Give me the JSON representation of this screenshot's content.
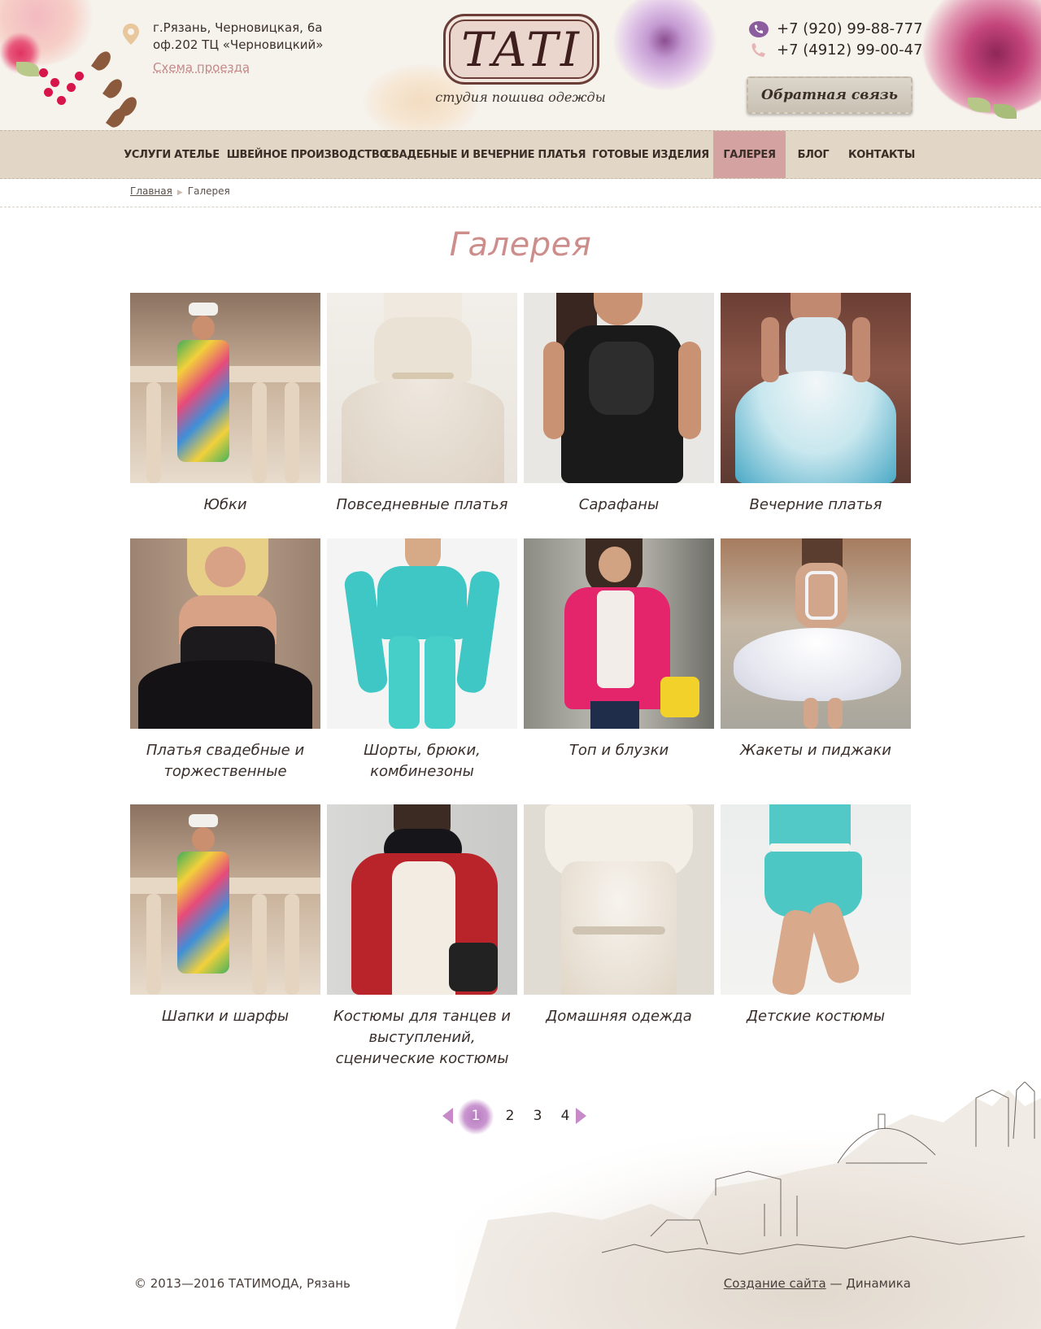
{
  "header": {
    "address_line1": "г.Рязань, Черновицкая, 6а",
    "address_line2": "оф.202  ТЦ «Черновицкий»",
    "route_link": "Схема проезда",
    "logo_text": "TATI",
    "tagline": "студия пошива одежды",
    "phone_1": "+7 (920) 99-88-777",
    "phone_2": "+7 (4912) 99-00-47",
    "callback_button": "Обратная связь"
  },
  "nav": {
    "items": [
      {
        "label": "УСЛУГИ АТЕЛЬЕ"
      },
      {
        "label": "ШВЕЙНОЕ ПРОИЗВОДСТВО"
      },
      {
        "label": "СВАДЕБНЫЕ И ВЕЧЕРНИЕ ПЛАТЬЯ"
      },
      {
        "label": "ГОТОВЫЕ ИЗДЕЛИЯ"
      },
      {
        "label": "ГАЛЕРЕЯ"
      },
      {
        "label": "БЛОГ"
      },
      {
        "label": "КОНТАКТЫ"
      }
    ],
    "active_label": "ГАЛЕРЕЯ"
  },
  "breadcrumb": {
    "home": "Главная",
    "current": "Галерея"
  },
  "page": {
    "title": "Галерея"
  },
  "gallery": {
    "items": [
      {
        "caption": "Юбки"
      },
      {
        "caption": "Повседневные платья"
      },
      {
        "caption": "Сарафаны"
      },
      {
        "caption": "Вечерние платья"
      },
      {
        "caption": "Платья свадебные и торжественные"
      },
      {
        "caption": "Шорты, брюки, комбинезоны"
      },
      {
        "caption": "Топ и блузки"
      },
      {
        "caption": "Жакеты и пиджаки"
      },
      {
        "caption": "Шапки и шарфы"
      },
      {
        "caption": "Костюмы для танцев и выступлений, сценические костюмы"
      },
      {
        "caption": "Домашняя одежда"
      },
      {
        "caption": "Детские костюмы"
      }
    ]
  },
  "pagination": {
    "pages": [
      "1",
      "2",
      "3",
      "4"
    ],
    "current": "1"
  },
  "footer": {
    "copyright": "© 2013—2016 ТАТИМОДА, Рязань",
    "credit_link": "Создание сайта",
    "credit_suffix": "— Динамика"
  },
  "colors": {
    "accent_pink": "#cc8d8b",
    "nav_bg": "#e2d6c6",
    "nav_active": "#d5a2a2",
    "pager_accent": "#c789c7"
  }
}
